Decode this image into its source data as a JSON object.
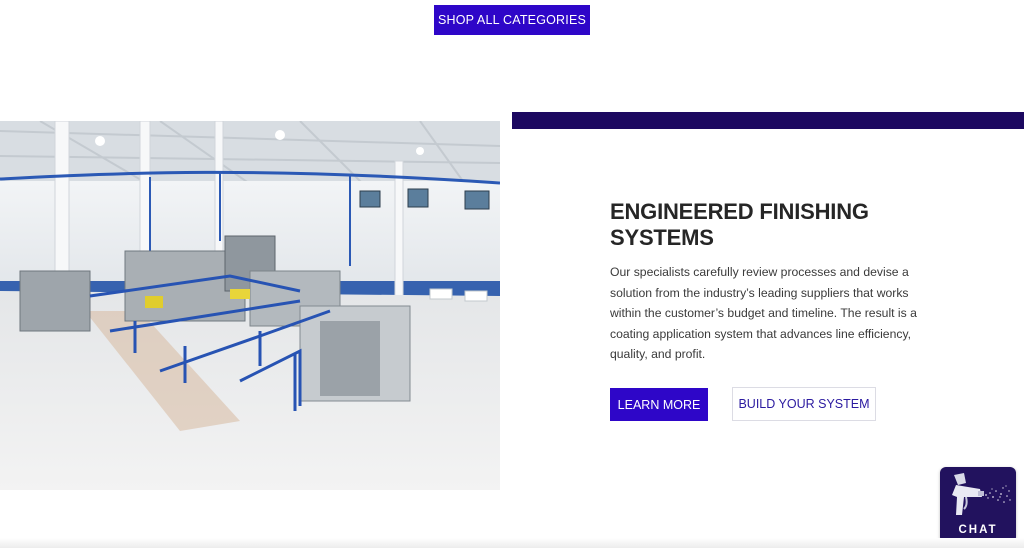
{
  "top_cta": {
    "label": "SHOP ALL CATEGORIES"
  },
  "feature": {
    "title": "ENGINEERED FINISHING SYSTEMS",
    "description": "Our specialists carefully review processes and devise a solution from the industry’s leading suppliers that works within the customer’s budget and timeline. The result is a coating application system that advances line efficiency, quality, and profit.",
    "primary_button": "LEARN MORE",
    "secondary_button": "BUILD YOUR SYSTEM"
  },
  "chat_widget": {
    "label": "CHAT",
    "icon": "spray-gun-icon"
  },
  "colors": {
    "accent": "#2e06c8",
    "accent_dark": "#1c0860",
    "chat_bg": "#22125e"
  }
}
